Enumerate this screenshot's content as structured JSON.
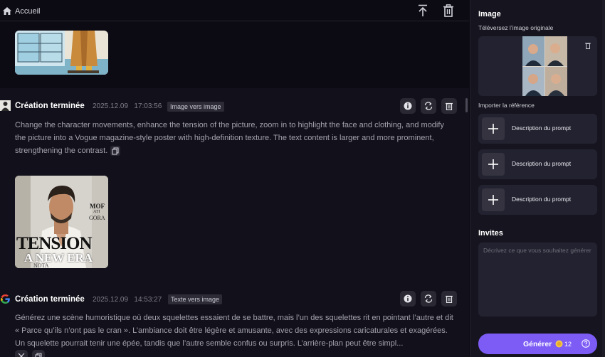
{
  "header": {
    "home_label": "Accueil"
  },
  "tasks": [
    {
      "title": "Création terminée",
      "timestamp": "2025.12.09   17:03:56",
      "mode_tag": "Image vers image",
      "prompt": "Change the character movements, enhance the tension of the picture, zoom in to highlight the face and clothing, and modify the picture into a Vogue magazine-style poster with high-definition texture. The text content is larger and more prominent, strengthening the contrast.",
      "poster": {
        "mof": "MOF",
        "ati": "ATI",
        "gora": "GORA",
        "tension": "TENSION",
        "new_era": "A NEW ERA",
        "nota": "NOTA"
      }
    },
    {
      "title": "Création terminée",
      "timestamp": "2025.12.09   14:53:27",
      "mode_tag": "Texte vers image",
      "prompt": "Générez une scène humoristique où deux squelettes essaient de se battre, mais l’un des squelettes rit en pointant l’autre et dit « Parce qu’ils n’ont pas le cran ». L’ambiance doit être légère et amusante, avec des expressions caricaturales et exagérées. Un squelette pourrait tenir une épée, tandis que l’autre semble confus ou surpris. L’arrière-plan peut être simpl..."
    }
  ],
  "panel": {
    "image_title": "Image",
    "upload_label": "Téléversez l’image originale",
    "reference_label": "Importer la référence",
    "reference_rows": [
      {
        "label": "Description du prompt"
      },
      {
        "label": "Description du prompt"
      },
      {
        "label": "Description du prompt"
      }
    ],
    "prompts_title": "Invites",
    "prompt_placeholder": "Décrivez ce que vous souhaitez générer",
    "generate_label": "Générer",
    "credit_count": "12"
  },
  "colors": {
    "accent": "#7c5cf5",
    "background": "#0c0b14",
    "card": "#12111b",
    "panel": "#16151f"
  }
}
